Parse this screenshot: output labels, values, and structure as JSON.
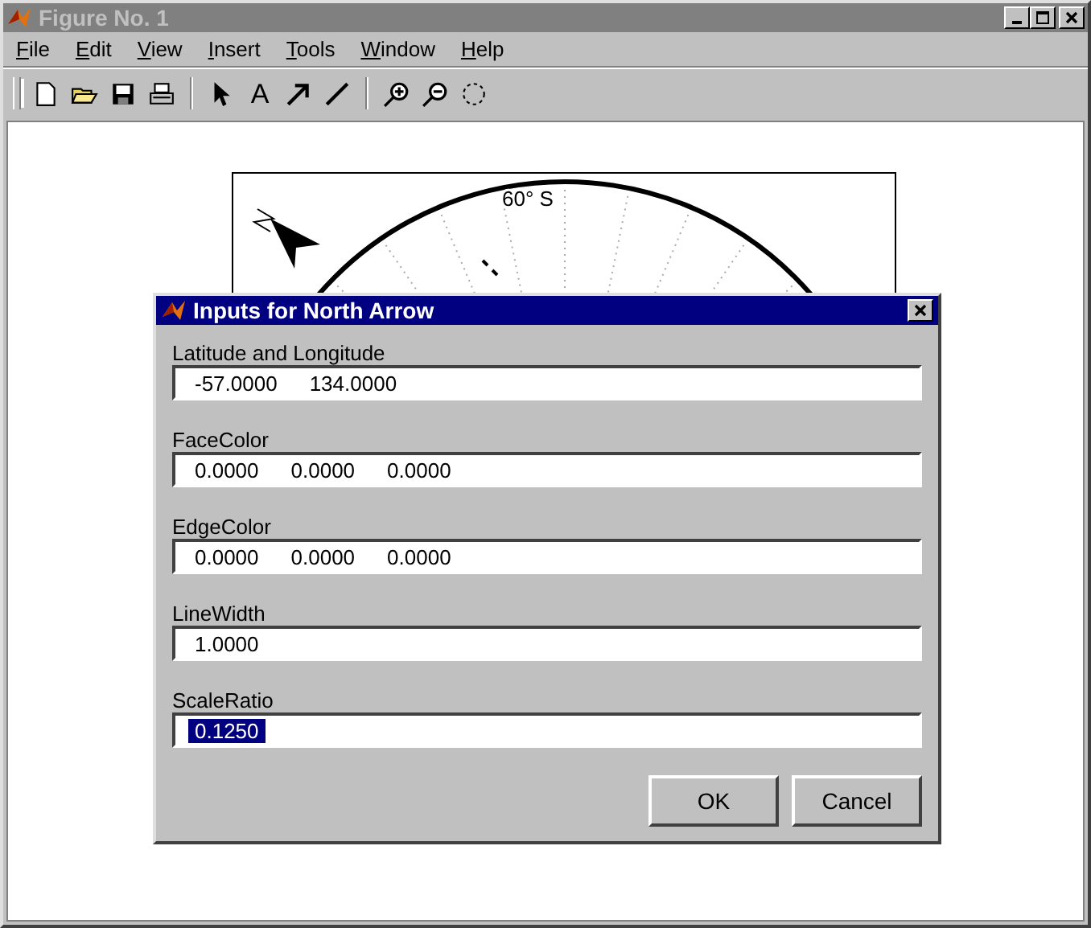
{
  "window": {
    "title": "Figure No. 1",
    "active": false
  },
  "menu": [
    "File",
    "Edit",
    "View",
    "Insert",
    "Tools",
    "Window",
    "Help"
  ],
  "toolbar": [
    [
      {
        "kind": "new"
      },
      {
        "kind": "open"
      },
      {
        "kind": "save"
      },
      {
        "kind": "print"
      }
    ],
    [
      {
        "kind": "pointer"
      },
      {
        "kind": "text",
        "label": "A"
      },
      {
        "kind": "arrow"
      },
      {
        "kind": "line"
      }
    ],
    [
      {
        "kind": "zoom-in"
      },
      {
        "kind": "zoom-out"
      },
      {
        "kind": "rotate"
      }
    ]
  ],
  "plot": {
    "labels": [
      "60° S"
    ]
  },
  "dialog": {
    "title": "Inputs for North Arrow",
    "fields": [
      {
        "label": "Latitude and Longitude",
        "values": [
          "-57.0000",
          "134.0000"
        ],
        "selected": false
      },
      {
        "label": "FaceColor",
        "values": [
          "0.0000",
          "0.0000",
          "0.0000"
        ],
        "selected": false
      },
      {
        "label": "EdgeColor",
        "values": [
          "0.0000",
          "0.0000",
          "0.0000"
        ],
        "selected": false
      },
      {
        "label": "LineWidth",
        "values": [
          "1.0000"
        ],
        "selected": false
      },
      {
        "label": "ScaleRatio",
        "values": [
          "0.1250"
        ],
        "selected": true
      }
    ],
    "buttons": [
      "OK",
      "Cancel"
    ]
  }
}
